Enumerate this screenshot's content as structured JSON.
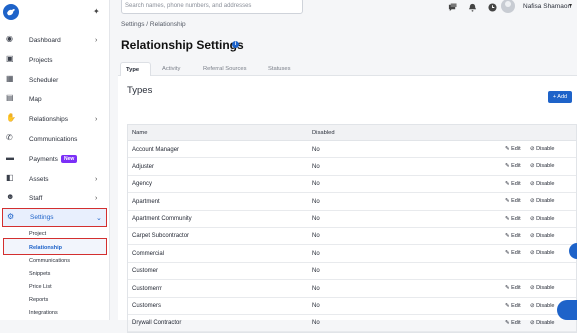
{
  "sidebar": {
    "items": [
      {
        "label": "Dashboard",
        "icon": "dashboard-icon",
        "chevron": true
      },
      {
        "label": "Projects",
        "icon": "briefcase-icon",
        "chevron": false
      },
      {
        "label": "Scheduler",
        "icon": "calendar-icon",
        "chevron": false
      },
      {
        "label": "Map",
        "icon": "map-icon",
        "chevron": false
      },
      {
        "label": "Relationships",
        "icon": "handshake-icon",
        "chevron": true
      },
      {
        "label": "Communications",
        "icon": "phone-icon",
        "chevron": false
      },
      {
        "label": "Payments",
        "icon": "wallet-icon",
        "chevron": false,
        "badge": "New"
      },
      {
        "label": "Assets",
        "icon": "truck-icon",
        "chevron": true
      },
      {
        "label": "Staff",
        "icon": "users-icon",
        "chevron": true
      },
      {
        "label": "Settings",
        "icon": "gear-icon",
        "chevron": true,
        "active": true
      }
    ],
    "sub_items": [
      "Project",
      "Relationship",
      "Communications",
      "Snippets",
      "Price List",
      "Reports",
      "Integrations"
    ]
  },
  "topbar": {
    "search_placeholder": "Search names, phone numbers, and addresses",
    "username": "Nafisa Shamaon"
  },
  "breadcrumb": "Settings / Relationship",
  "page_title": "Relationship Settings",
  "tabs": [
    "Type",
    "Activity",
    "Referral Sources",
    "Statuses"
  ],
  "types_title": "Types",
  "add_label": "+ Add",
  "table": {
    "headers": [
      "Name",
      "Disabled"
    ],
    "edit_label": "Edit",
    "disable_label": "Disable",
    "rows": [
      {
        "name": "Account Manager",
        "disabled": "No",
        "actions": true
      },
      {
        "name": "Adjuster",
        "disabled": "No",
        "actions": true
      },
      {
        "name": "Agency",
        "disabled": "No",
        "actions": true
      },
      {
        "name": "Apartment",
        "disabled": "No",
        "actions": true
      },
      {
        "name": "Apartment Community",
        "disabled": "No",
        "actions": true
      },
      {
        "name": "Carpet Subcontractor",
        "disabled": "No",
        "actions": true
      },
      {
        "name": "Commercial",
        "disabled": "No",
        "actions": true
      },
      {
        "name": "Customer",
        "disabled": "No",
        "actions": false
      },
      {
        "name": "Customerrr",
        "disabled": "No",
        "actions": true
      },
      {
        "name": "Customers",
        "disabled": "No",
        "actions": true
      },
      {
        "name": "Drywall Contractor",
        "disabled": "No",
        "actions": true
      }
    ]
  },
  "colors": {
    "accent": "#1e63c9",
    "badge": "#7b2ff7",
    "highlight": "#d32f2f"
  }
}
